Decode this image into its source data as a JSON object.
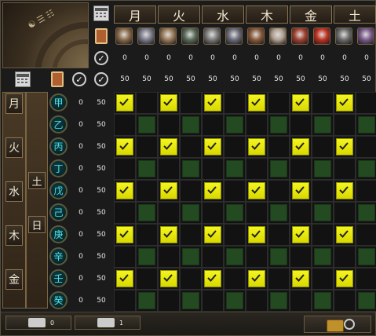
{
  "day_columns": [
    "月",
    "火",
    "水",
    "木",
    "金",
    "土"
  ],
  "left_days": [
    "月",
    "火",
    "水",
    "木",
    "金"
  ],
  "left_merged": [
    "土",
    "日"
  ],
  "stems": [
    "甲",
    "乙",
    "丙",
    "丁",
    "戊",
    "己",
    "庚",
    "辛",
    "壬",
    "癸"
  ],
  "row_counts": [
    "0",
    "0",
    "0",
    "0",
    "0",
    "0",
    "0",
    "0",
    "0",
    "0"
  ],
  "row_limits": [
    "50",
    "50",
    "50",
    "50",
    "50",
    "50",
    "50",
    "50",
    "50",
    "50"
  ],
  "header_counts": [
    "0",
    "0",
    "0",
    "0",
    "0",
    "0",
    "0",
    "0",
    "0",
    "0",
    "0",
    "0"
  ],
  "header_limits": [
    "50",
    "50",
    "50",
    "50",
    "50",
    "50",
    "50",
    "50",
    "50",
    "50",
    "50",
    "50"
  ],
  "left_header": {
    "count": "0",
    "limit": "50"
  },
  "rows_active": [
    true,
    false,
    true,
    false,
    true,
    false,
    true,
    false,
    true,
    false
  ],
  "bottom": {
    "left_count": "0",
    "mid_count": "1"
  },
  "colors": {
    "active": "#f0f000",
    "inactive": "#244a22",
    "portraits": [
      "#8a6a4a",
      "#7a7a8a",
      "#9a7a5a",
      "#5a6a5a",
      "#7a7a7a",
      "#6a6a7a",
      "#8a5a3a",
      "#b0a090",
      "#a04030",
      "#c03020",
      "#6a6a6a",
      "#7a5a8a"
    ]
  },
  "icons": {
    "calendar": "calendar-icon",
    "card": "card-icon",
    "check": "check-circle-icon",
    "card_check": "card-check-icon",
    "chest": "chest-icon"
  }
}
